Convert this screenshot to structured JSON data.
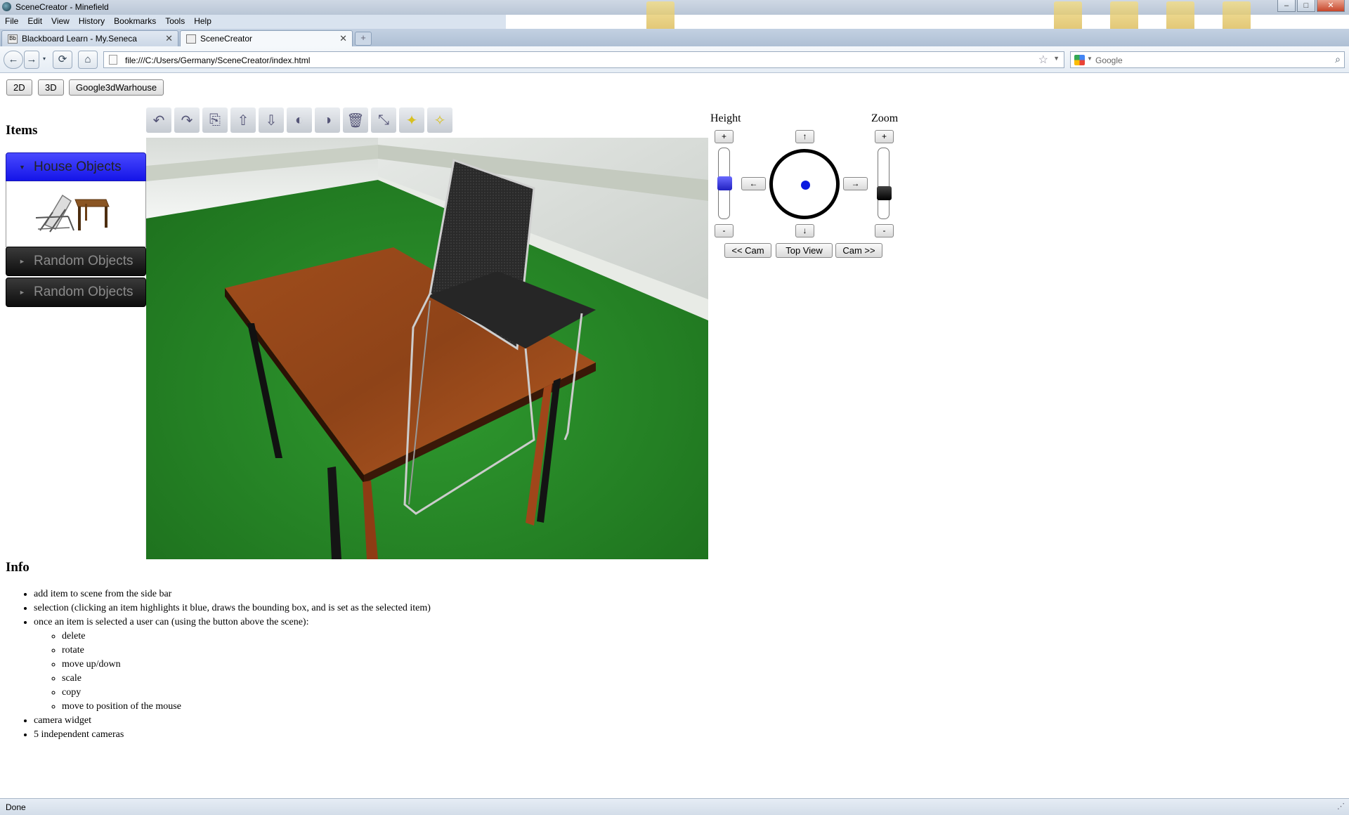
{
  "window": {
    "title": "SceneCreator - Minefield"
  },
  "menu": [
    "File",
    "Edit",
    "View",
    "History",
    "Bookmarks",
    "Tools",
    "Help"
  ],
  "tabs": [
    {
      "label": "Blackboard Learn - My.Seneca",
      "active": false
    },
    {
      "label": "SceneCreator",
      "active": true
    }
  ],
  "nav": {
    "url": "file:///C:/Users/Germany/SceneCreator/index.html",
    "search_placeholder": "Google"
  },
  "modes": {
    "two_d": "2D",
    "three_d": "3D",
    "warehouse": "Google3dWarhouse"
  },
  "sidebar": {
    "heading": "Items",
    "groups": [
      {
        "label": "House Objects",
        "expanded": true,
        "items": [
          "folding-chair-thumbnail",
          "wooden-table-thumbnail"
        ]
      },
      {
        "label": "Random Objects",
        "expanded": false
      },
      {
        "label": "Random Objects",
        "expanded": false
      }
    ]
  },
  "toolbar": [
    "undo-icon",
    "redo-icon",
    "copy-icon",
    "move-up-icon",
    "move-down-icon",
    "rotate-left-icon",
    "rotate-right-icon",
    "delete-icon",
    "scale-icon",
    "light-icon",
    "light-dropdown-icon"
  ],
  "camera": {
    "height_label": "Height",
    "zoom_label": "Zoom",
    "plus": "+",
    "minus": "-",
    "up": "↑",
    "down": "↓",
    "left": "←",
    "right": "→",
    "prev_cam": "<< Cam",
    "top_view": "Top View",
    "next_cam": "Cam >>",
    "height_level": 0.5,
    "zoom_level": 0.33
  },
  "info": {
    "heading": "Info",
    "items": [
      "add item to scene from the side bar",
      "selection (clicking an item highlights it blue, draws the bounding box, and is set as the selected item)",
      "once an item is selected a user can (using the button above the scene):"
    ],
    "sub_items": [
      "delete",
      "rotate",
      "move up/down",
      "scale",
      "copy",
      "move to position of the mouse"
    ],
    "tail_items": [
      "camera widget",
      "5 independent cameras"
    ]
  },
  "status": "Done",
  "colors": {
    "selected_group": "#1414e8",
    "scene_floor": "#2d8a2d",
    "joystick_dot": "#0a1ae0"
  }
}
